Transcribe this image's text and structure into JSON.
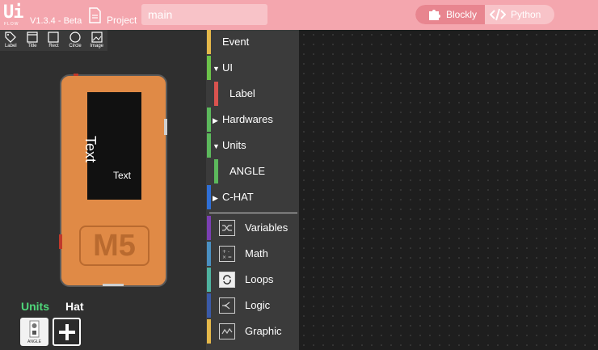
{
  "header": {
    "logo_ui": "Ui",
    "logo_flow": "FLOW",
    "version": "V1.3.4 - Beta",
    "project_label": "Project",
    "filename": "main",
    "mode_blockly": "Blockly",
    "mode_python": "Python",
    "active_mode": "Blockly",
    "accent_color": "#f4a6ae",
    "active_color": "#e8858f"
  },
  "widgets": [
    {
      "label": "Label",
      "icon": "tag-icon"
    },
    {
      "label": "Title",
      "icon": "title-icon"
    },
    {
      "label": "Rect",
      "icon": "rect-icon"
    },
    {
      "label": "Circle",
      "icon": "circle-icon"
    },
    {
      "label": "Image",
      "icon": "image-icon"
    }
  ],
  "device": {
    "screen_title": "Text",
    "screen_label": "Text",
    "logo": "M5",
    "body_color": "#e08a46"
  },
  "units_panel": {
    "units_tab": "Units",
    "hat_tab": "Hat",
    "unit_card_caption": "ANGLE"
  },
  "toolbox": {
    "items": [
      {
        "label": "Event",
        "color": "#e5b84a",
        "arrow": ""
      },
      {
        "label": "UI",
        "color": "#6cc24a",
        "arrow": "▼"
      },
      {
        "label": "Label",
        "color": "#d9534f",
        "arrow": "",
        "indent": true
      },
      {
        "label": "Hardwares",
        "color": "#5cb85c",
        "arrow": "▶"
      },
      {
        "label": "Units",
        "color": "#5cb85c",
        "arrow": "▼"
      },
      {
        "label": "ANGLE",
        "color": "#5cb85c",
        "arrow": "",
        "indent": true
      },
      {
        "label": "C-HAT",
        "color": "#2f6fd6",
        "arrow": "▶"
      },
      {
        "label": "Variables",
        "color": "#7b3fb3",
        "icon": "shuffle-icon"
      },
      {
        "label": "Math",
        "color": "#4a90c2",
        "icon": "math-icon"
      },
      {
        "label": "Loops",
        "color": "#4fb3a0",
        "icon": "loop-icon"
      },
      {
        "label": "Logic",
        "color": "#3a5aa8",
        "icon": "logic-icon"
      },
      {
        "label": "Graphic",
        "color": "#e5b84a",
        "icon": "graphic-icon"
      }
    ]
  }
}
